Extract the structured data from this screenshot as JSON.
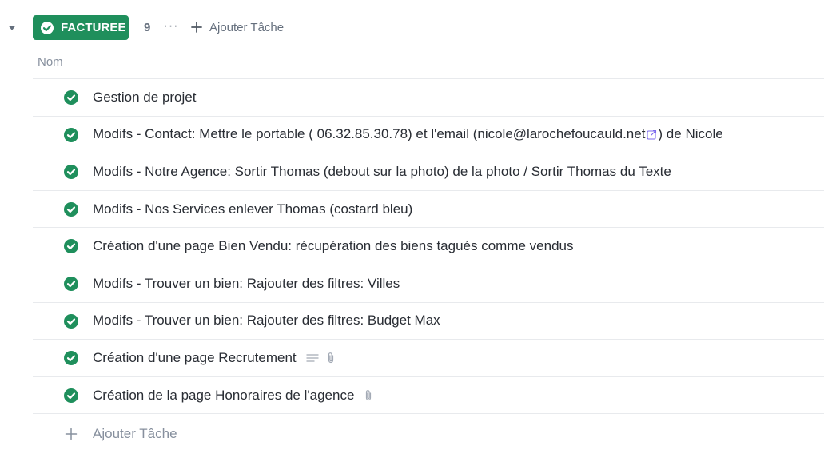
{
  "group": {
    "status_label": "FACTUREE",
    "status_color": "#1f8f5c",
    "task_count": "9",
    "more_label": "···",
    "add_task_label": "Ajouter Tâche"
  },
  "columns": {
    "name_header": "Nom"
  },
  "tasks": [
    {
      "name": "Gestion de projet",
      "icons": []
    },
    {
      "name_before": "Modifs - Contact: Mettre le portable ( 06.32.85.30.78) et l'email (nicole@larochefoucauld.net",
      "name_after": ") de Nicole",
      "icons": [
        "external-link-icon"
      ]
    },
    {
      "name": "Modifs - Notre Agence: Sortir Thomas (debout sur la photo) de la photo / Sortir Thomas du Texte",
      "icons": []
    },
    {
      "name": "Modifs - Nos Services enlever Thomas (costard bleu)",
      "icons": []
    },
    {
      "name": "Création d'une page Bien Vendu: récupération des biens tagués comme vendus",
      "icons": []
    },
    {
      "name": "Modifs - Trouver un bien: Rajouter des filtres: Villes",
      "icons": []
    },
    {
      "name": "Modifs - Trouver un bien: Rajouter des filtres: Budget Max",
      "icons": []
    },
    {
      "name": "Création d'une page Recrutement",
      "icons": [
        "description-icon",
        "attachment-icon"
      ]
    },
    {
      "name": "Création de la page Honoraires de l'agence",
      "icons": [
        "attachment-icon"
      ]
    }
  ],
  "footer": {
    "add_task_label": "Ajouter Tâche"
  }
}
